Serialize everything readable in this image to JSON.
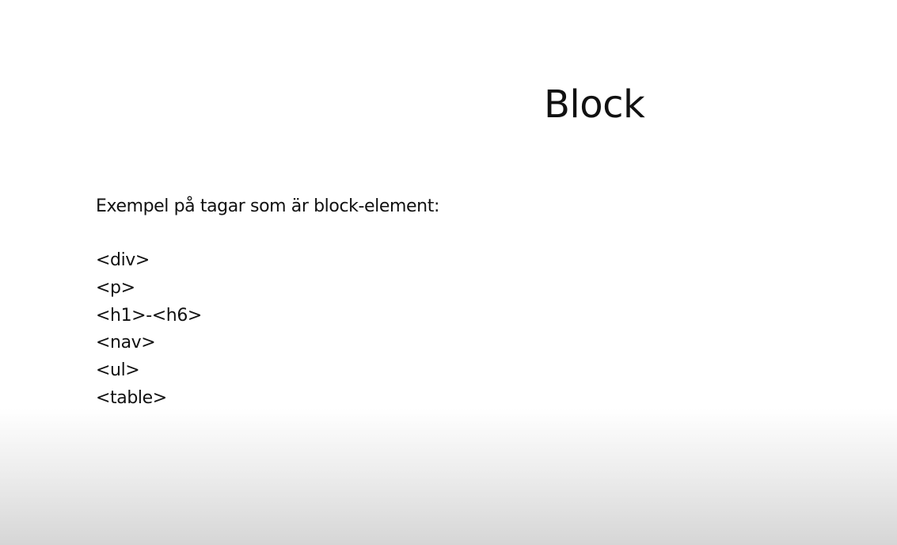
{
  "slide": {
    "title": "Block",
    "intro": "Exempel på tagar som är block-element:",
    "tags": [
      "<div>",
      "<p>",
      "<h1>-<h6>",
      "<nav>",
      "<ul>",
      "<table>"
    ]
  },
  "colors": {
    "background": "#ffffff",
    "text": "#111111",
    "bottom_gradient": "#d6d6d6"
  }
}
